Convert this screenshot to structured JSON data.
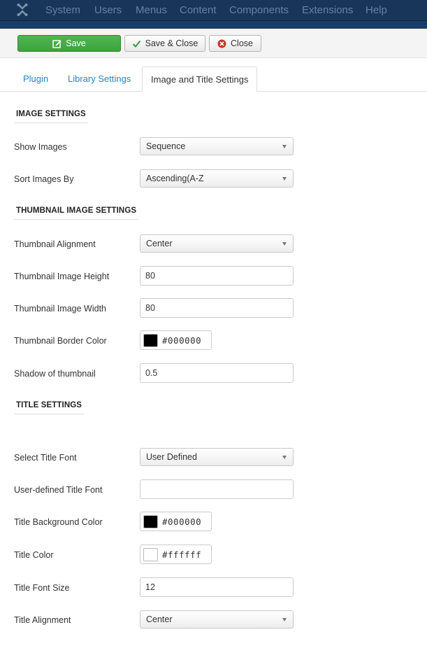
{
  "menu": [
    "System",
    "Users",
    "Menus",
    "Content",
    "Components",
    "Extensions",
    "Help"
  ],
  "toolbar": {
    "save_label": "Save",
    "save_close_label": "Save & Close",
    "close_label": "Close"
  },
  "tabs": [
    "Plugin",
    "Library Settings",
    "Image and Title Settings"
  ],
  "sections": {
    "image": "IMAGE SETTINGS",
    "thumbnail": "THUMBNAIL IMAGE SETTINGS",
    "title": "TITLE SETTINGS"
  },
  "fields": {
    "show_images": {
      "label": "Show Images",
      "value": "Sequence"
    },
    "sort_images": {
      "label": "Sort Images By",
      "value": "Ascending(A-Z"
    },
    "thumb_align": {
      "label": "Thumbnail Alignment",
      "value": "Center"
    },
    "thumb_height": {
      "label": "Thumbnail Image Height",
      "value": "80"
    },
    "thumb_width": {
      "label": "Thumbnail Image Width",
      "value": "80"
    },
    "thumb_border": {
      "label": "Thumbnail Border Color",
      "value": "#000000"
    },
    "thumb_shadow": {
      "label": "Shadow of thumbnail",
      "value": "0.5"
    },
    "title_font": {
      "label": "Select Title Font",
      "value": "User Defined"
    },
    "user_font": {
      "label": "User-defined Title Font",
      "value": ""
    },
    "title_bg": {
      "label": "Title Background Color",
      "value": "#000000"
    },
    "title_color": {
      "label": "Title Color",
      "value": "#ffffff"
    },
    "title_size": {
      "label": "Title Font Size",
      "value": "12"
    },
    "title_align": {
      "label": "Title Alignment",
      "value": "Center"
    }
  },
  "colors": {
    "accent": "#2a83c2",
    "save_green": "#46ad46",
    "topbar": "#17365a"
  }
}
